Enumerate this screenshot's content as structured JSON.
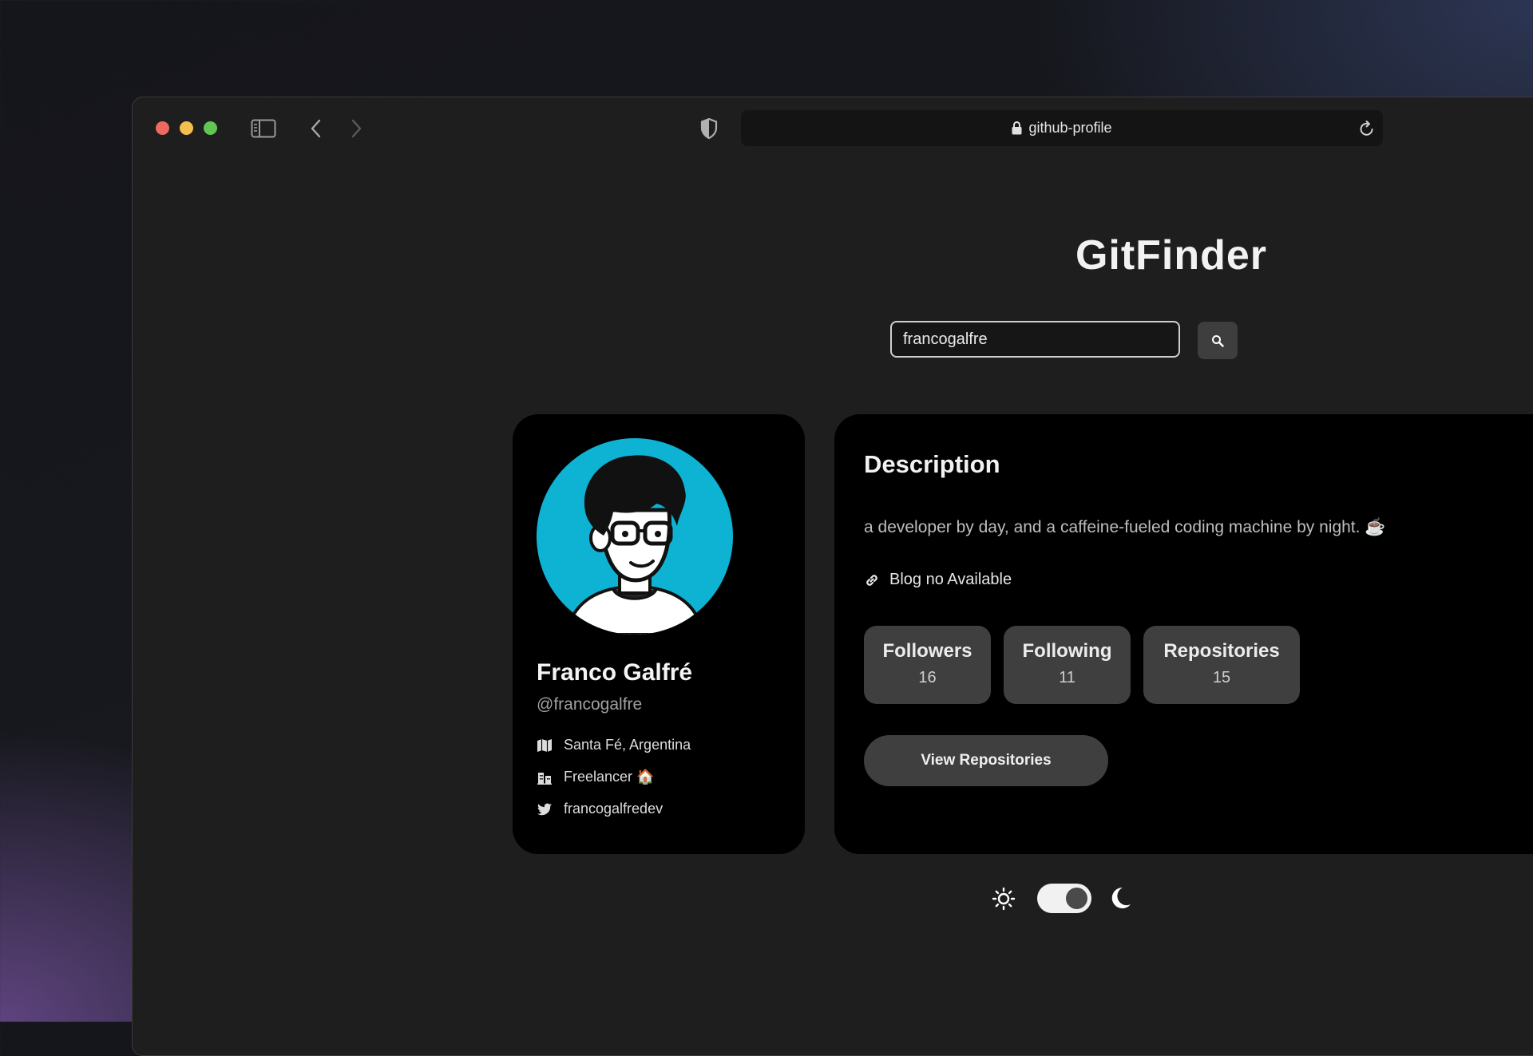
{
  "browser": {
    "url": "github-profile"
  },
  "app": {
    "title": "GitFinder"
  },
  "search": {
    "value": "francogalfre"
  },
  "profile": {
    "name": "Franco Galfré",
    "handle": "@francogalfre",
    "location": "Santa Fé, Argentina",
    "company": "Freelancer 🏠",
    "twitter": "francogalfredev"
  },
  "details": {
    "heading": "Description",
    "bio": "a developer by day, and a caffeine-fueled coding machine by night. ☕",
    "blog": "Blog no Available",
    "stats": [
      {
        "label": "Followers",
        "value": "16"
      },
      {
        "label": "Following",
        "value": "11"
      },
      {
        "label": "Repositories",
        "value": "15"
      }
    ],
    "view_button": "View Repositories"
  },
  "theme": {
    "mode": "dark",
    "light_icon": "sun-icon",
    "dark_icon": "moon-icon"
  },
  "colors": {
    "page_bg": "#1e1e1e",
    "card_bg": "#000000",
    "avatar_bg": "#0eb3d3",
    "stat_bg": "#3f3f3f"
  }
}
